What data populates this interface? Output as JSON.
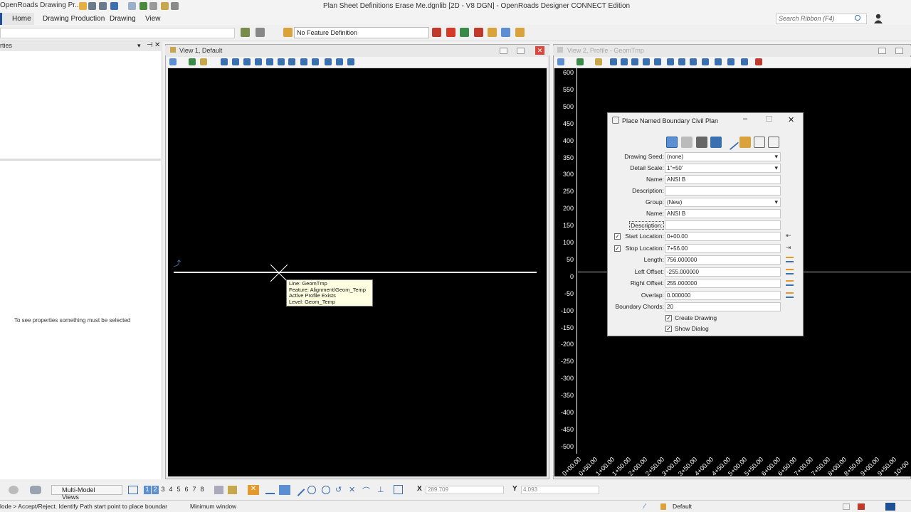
{
  "titlebar": {
    "app_tab": "OpenRoads Drawing Pr...",
    "title": "Plan Sheet Definitions Erase Me.dgnlib [2D - V8 DGN] - OpenRoads Designer CONNECT Edition"
  },
  "ribbon": {
    "tabs": [
      "Home",
      "Drawing Production",
      "Drawing",
      "View"
    ],
    "search_placeholder": "Search Ribbon (F4)"
  },
  "toolbar": {
    "feature_definition": "No Feature Definition"
  },
  "properties": {
    "title": "rties",
    "empty_message": "To see properties something must be selected"
  },
  "view1": {
    "title": "View 1, Default"
  },
  "view2": {
    "title": "View 2, Profile - GeomTmp",
    "y_ticks": [
      "600",
      "550",
      "500",
      "450",
      "400",
      "350",
      "300",
      "250",
      "200",
      "150",
      "100",
      "50",
      "0",
      "-50",
      "-100",
      "-150",
      "-200",
      "-250",
      "-300",
      "-350",
      "-400",
      "-450",
      "-500"
    ],
    "x_ticks": [
      "0+00.00",
      "0+50.00",
      "1+00.00",
      "1+50.00",
      "2+00.00",
      "2+50.00",
      "3+00.00",
      "3+50.00",
      "4+00.00",
      "4+50.00",
      "5+00.00",
      "5+50.00",
      "6+00.00",
      "6+50.00",
      "7+00.00",
      "7+50.00",
      "8+00.00",
      "8+50.00",
      "9+00.00",
      "9+50.00",
      "10+00"
    ]
  },
  "tooltip": {
    "line1": "Line: GeomTmp",
    "line2": "Feature: Alignment\\Geom_Temp",
    "line3": "Active Profile Exists",
    "line4": "Level: Geom_Temp"
  },
  "dialog": {
    "title": "Place Named Boundary Civil Plan",
    "fields": {
      "drawing_seed_label": "Drawing Seed:",
      "drawing_seed": "(none)",
      "detail_scale_label": "Detail Scale:",
      "detail_scale": "1\"=50'",
      "name_label": "Name:",
      "name": "ANSI B",
      "description_label": "Description:",
      "description": "",
      "group_label": "Group:",
      "group": "(New)",
      "name2_label": "Name:",
      "name2": "ANSI B",
      "description2_label": "Description:",
      "description2": "",
      "start_location_label": "Start Location:",
      "start_location": "0+00.00",
      "stop_location_label": "Stop Location:",
      "stop_location": "7+56.00",
      "length_label": "Length:",
      "length": "756.000000",
      "left_offset_label": "Left Offset:",
      "left_offset": "-255.000000",
      "right_offset_label": "Right Offset:",
      "right_offset": "255.000000",
      "overlap_label": "Overlap:",
      "overlap": "0.000000",
      "boundary_chords_label": "Boundary Chords:",
      "boundary_chords": "20"
    },
    "checks": {
      "create_drawing": "Create Drawing",
      "show_dialog": "Show Dialog"
    }
  },
  "bottombar": {
    "view_group": "Multi-Model Views",
    "x_label": "X",
    "x_value": "289.709",
    "y_label": "Y",
    "y_value": "4.093"
  },
  "status": {
    "prompt": "lode > Accept/Reject. Identify Path start point to place boundar",
    "window_msg": "Minimum window",
    "level": "Default"
  }
}
